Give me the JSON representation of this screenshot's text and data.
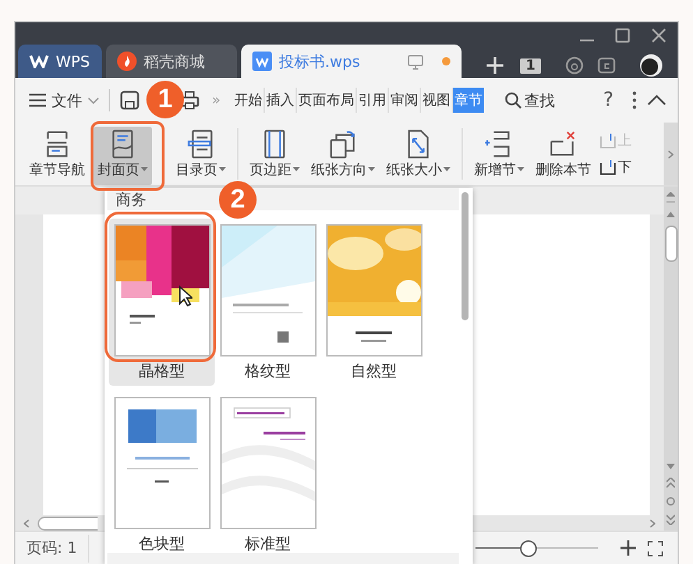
{
  "tabs": [
    {
      "label": "WPS",
      "kind": "home",
      "selected": false
    },
    {
      "label": "稻壳商城",
      "kind": "store",
      "selected": false
    },
    {
      "label": "投标书.wps",
      "kind": "doc",
      "selected": true,
      "unsaved": true
    }
  ],
  "tab_count": "1",
  "menu": {
    "file": "文件",
    "more": "»",
    "search": "查找",
    "help": "?",
    "items": [
      {
        "label": "开始",
        "selected": false
      },
      {
        "label": "插入",
        "selected": false
      },
      {
        "label": "页面布局",
        "selected": false
      },
      {
        "label": "引用",
        "selected": false
      },
      {
        "label": "审阅",
        "selected": false
      },
      {
        "label": "视图",
        "selected": false
      },
      {
        "label": "章节",
        "selected": true
      }
    ]
  },
  "ribbon": [
    {
      "label": "章节导航",
      "kind": "nav",
      "dropdown": false,
      "selected": false
    },
    {
      "label": "封面页",
      "kind": "cover",
      "dropdown": true,
      "selected": true
    },
    {
      "label": "目录页",
      "kind": "toc",
      "dropdown": true,
      "selected": false
    },
    {
      "label": "页边距",
      "kind": "margin",
      "dropdown": true,
      "selected": false
    },
    {
      "label": "纸张方向",
      "kind": "orientation",
      "dropdown": true,
      "selected": false
    },
    {
      "label": "纸张大小",
      "kind": "size",
      "dropdown": true,
      "selected": false
    },
    {
      "label": "新增节",
      "kind": "add",
      "dropdown": true,
      "selected": false
    },
    {
      "label": "删除本节",
      "kind": "delete",
      "dropdown": false,
      "selected": false
    }
  ],
  "ribbon_small": [
    {
      "label": "上",
      "disabled": true
    },
    {
      "label": "下",
      "disabled": false
    }
  ],
  "gallery": {
    "category": "商务",
    "items": [
      {
        "label": "晶格型",
        "kind": "crystal",
        "selected": true
      },
      {
        "label": "格纹型",
        "kind": "lines",
        "selected": false
      },
      {
        "label": "自然型",
        "kind": "nature",
        "selected": false
      },
      {
        "label": "色块型",
        "kind": "block",
        "selected": false
      },
      {
        "label": "标准型",
        "kind": "standard",
        "selected": false
      }
    ]
  },
  "callouts": [
    "1",
    "2"
  ],
  "status_bar": {
    "page": "页码: 1",
    "zoom": {
      "level": 0.43
    }
  }
}
